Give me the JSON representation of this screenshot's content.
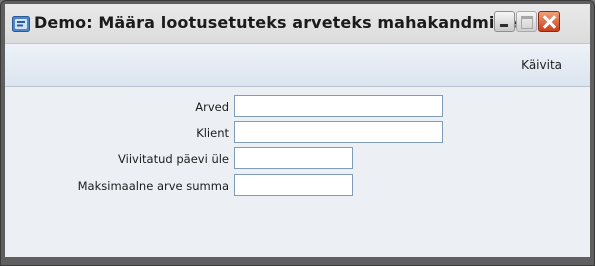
{
  "window": {
    "title": "Demo: Määra lootusetuteks arveteks mahakandmine",
    "controls": [
      "minimize-icon",
      "maximize-icon",
      "close-icon"
    ]
  },
  "toolbar": {
    "run_label": "Käivita"
  },
  "form": {
    "fields": [
      {
        "label": "Arved",
        "value": ""
      },
      {
        "label": "Klient",
        "value": ""
      },
      {
        "label": "Viivitatud päevi üle",
        "value": ""
      },
      {
        "label": "Maksimaalne arve summa",
        "value": ""
      }
    ]
  }
}
